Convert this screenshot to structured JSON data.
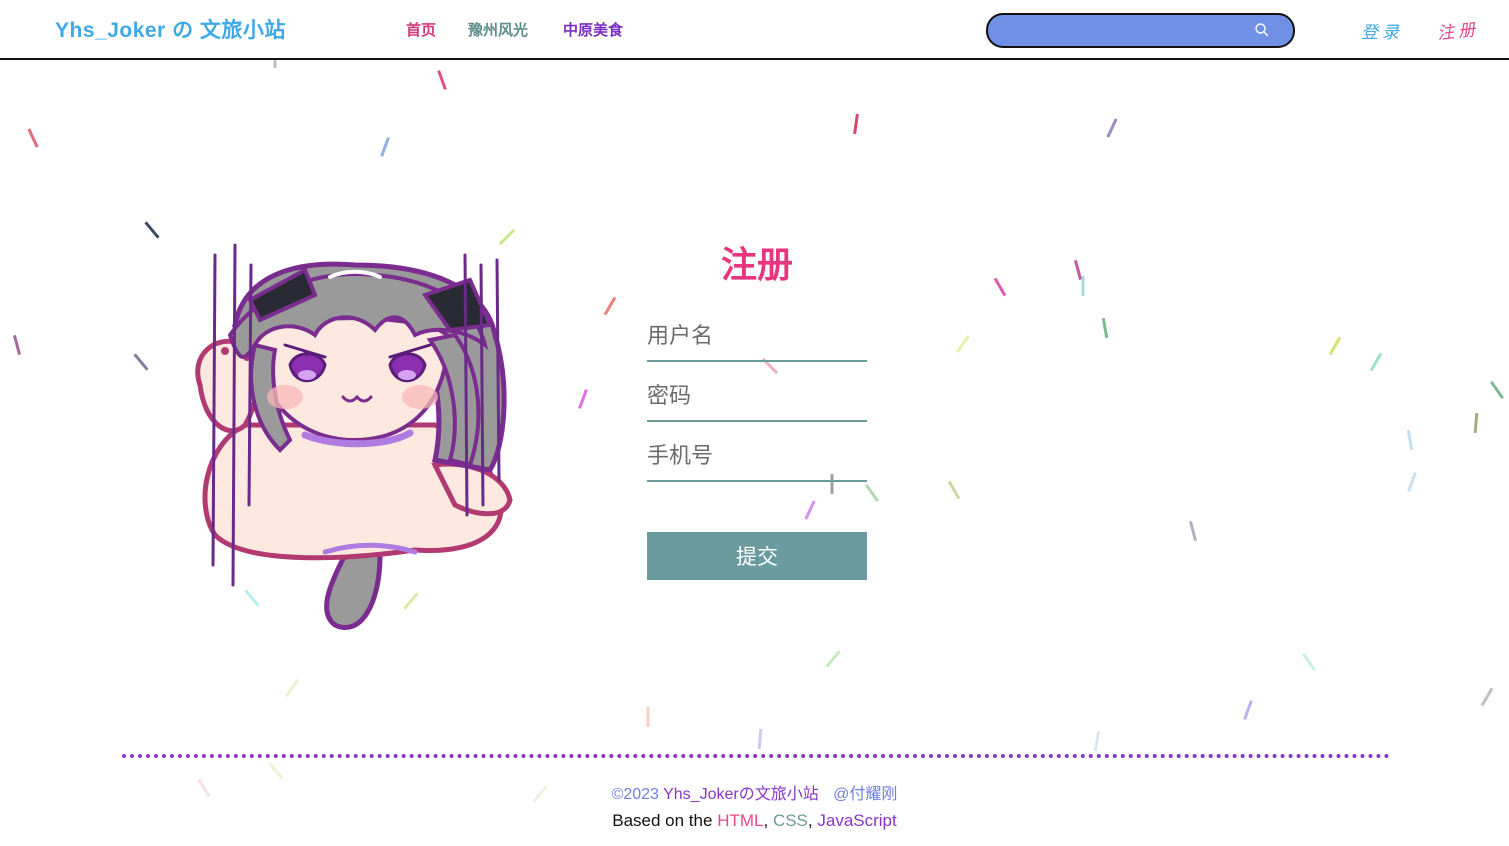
{
  "header": {
    "site_title": "Yhs_Joker の 文旅小站",
    "nav": {
      "home": "首页",
      "scenery": "豫州风光",
      "food": "中原美食"
    },
    "search": {
      "placeholder": "",
      "value": ""
    },
    "login": "登录",
    "register": "注册"
  },
  "form": {
    "title": "注册",
    "username_placeholder": "用户名",
    "password_placeholder": "密码",
    "phone_placeholder": "手机号",
    "submit_label": "提交"
  },
  "footer": {
    "copyright": "©2023",
    "site_name": "Yhs_Jokerの文旅小站",
    "author": "@付耀刚",
    "based_on": "Based on the",
    "tech_html": "HTML",
    "sep1": ",",
    "tech_css": "CSS",
    "sep2": ",",
    "tech_js": "JavaScript"
  },
  "colors": {
    "accent_blue": "#3fa9e8",
    "accent_pink": "#e8357f",
    "teal": "#6a9c9f",
    "purple": "#8a35c8",
    "search_fill": "#7090e6"
  }
}
